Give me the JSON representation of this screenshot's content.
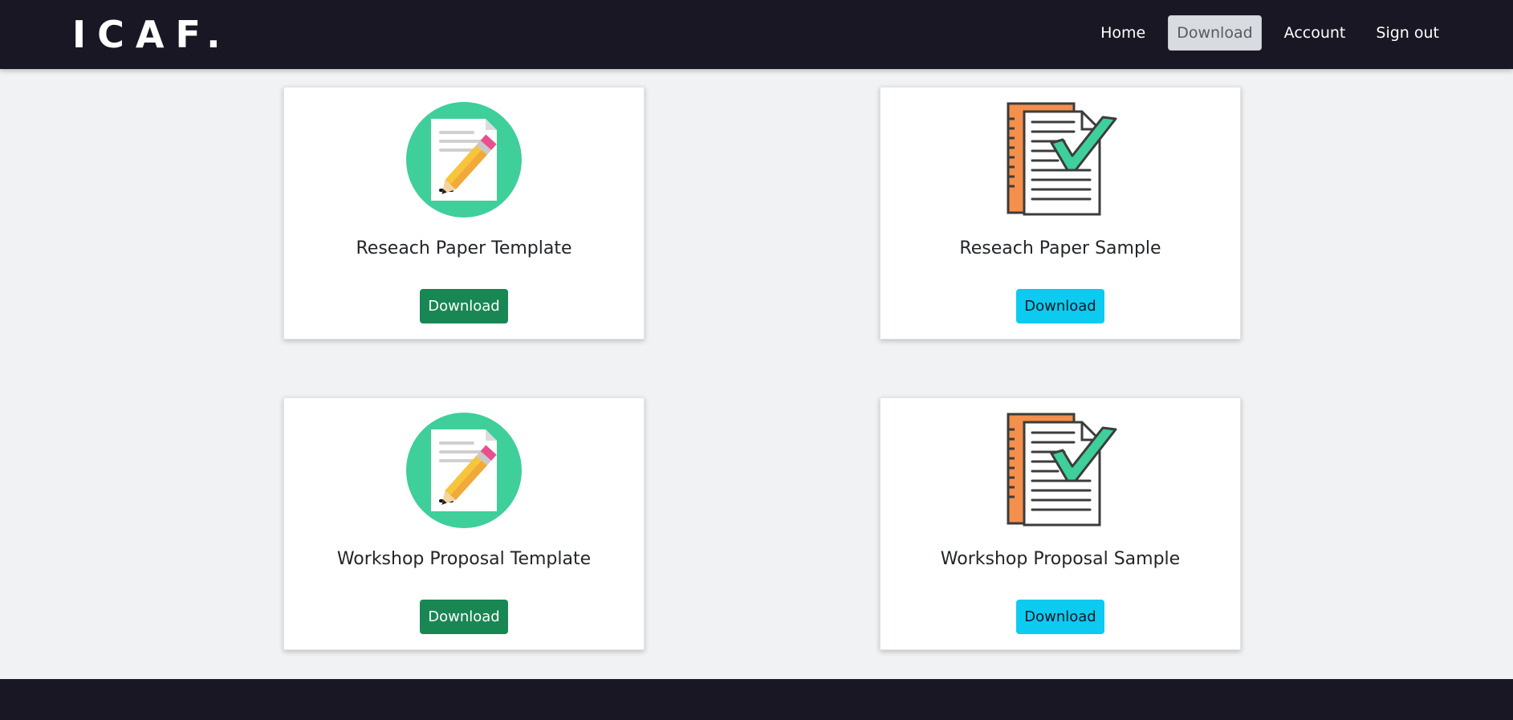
{
  "navbar": {
    "brand": "ICAF.",
    "links": [
      {
        "label": "Home",
        "active": false
      },
      {
        "label": "Download",
        "active": true
      },
      {
        "label": "Account",
        "active": false
      },
      {
        "label": "Sign out",
        "active": false
      }
    ]
  },
  "cards": [
    {
      "title": "Reseach Paper Template",
      "icon": "document-pencil-icon",
      "button_label": "Download",
      "button_color": "#198754"
    },
    {
      "title": "Reseach Paper Sample",
      "icon": "checked-documents-icon",
      "button_label": "Download",
      "button_color": "#0dcaf0"
    },
    {
      "title": "Workshop Proposal Template",
      "icon": "document-pencil-icon",
      "button_label": "Download",
      "button_color": "#198754"
    },
    {
      "title": "Workshop Proposal Sample",
      "icon": "checked-documents-icon",
      "button_label": "Download",
      "button_color": "#0dcaf0"
    }
  ],
  "colors": {
    "navbar_bg": "#191724",
    "page_bg": "#f1f2f4",
    "green": "#198754",
    "cyan": "#0dcaf0"
  }
}
